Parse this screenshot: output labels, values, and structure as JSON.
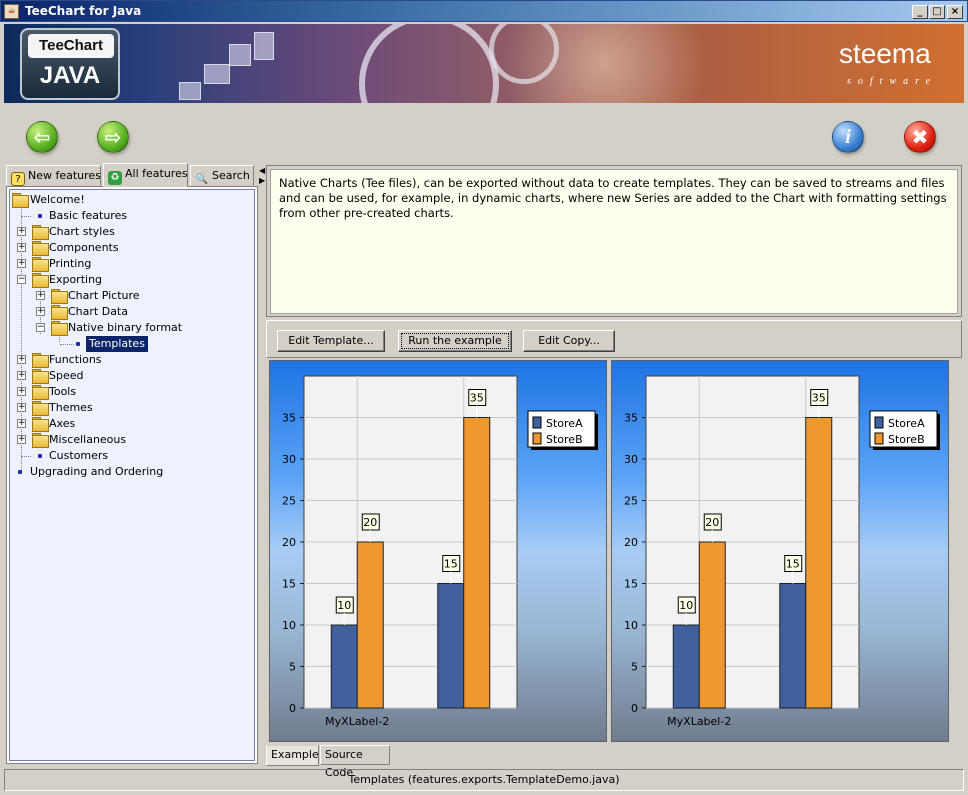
{
  "window": {
    "title": "TeeChart for Java"
  },
  "banner": {
    "logo_top": "TeeChart",
    "logo_bottom": "JAVA",
    "brand": "steema",
    "brand_sub": "software"
  },
  "toolbar": {
    "back_icon": "arrow-left-icon",
    "forward_icon": "arrow-right-icon",
    "info_icon": "info-icon",
    "close_icon": "close-icon",
    "back_glyph": "⇦",
    "forward_glyph": "⇨",
    "info_glyph": "i",
    "close_glyph": "✖"
  },
  "left_tabs": [
    {
      "label": "New features",
      "icon": "lightbulb-icon"
    },
    {
      "label": "All features",
      "icon": "recycle-icon"
    },
    {
      "label": "Search",
      "icon": "magnifier-icon"
    }
  ],
  "tree": {
    "root": "Welcome!",
    "items": [
      {
        "label": "Basic features"
      },
      {
        "label": "Chart styles"
      },
      {
        "label": "Components"
      },
      {
        "label": "Printing"
      },
      {
        "label": "Exporting"
      },
      {
        "label": "Chart Picture"
      },
      {
        "label": "Chart Data"
      },
      {
        "label": "Native binary format"
      },
      {
        "label": "Templates"
      },
      {
        "label": "Functions"
      },
      {
        "label": "Speed"
      },
      {
        "label": "Tools"
      },
      {
        "label": "Themes"
      },
      {
        "label": "Axes"
      },
      {
        "label": "Miscellaneous"
      },
      {
        "label": "Customers"
      },
      {
        "label": "Upgrading and Ordering"
      }
    ]
  },
  "description": "Native Charts (Tee files), can be exported without data to create templates. They can be saved to streams and files and can be used, for example, in dynamic charts, where new Series are added to the Chart with formatting settings from other pre-created charts.",
  "buttons": {
    "edit_template": "Edit Template...",
    "run_example": "Run the example",
    "edit_copy": "Edit Copy..."
  },
  "chart_data": [
    {
      "type": "bar",
      "categories": [
        "MyXLabel-2",
        ""
      ],
      "series": [
        {
          "name": "StoreA",
          "values": [
            10,
            15
          ],
          "color": "#4060a0"
        },
        {
          "name": "StoreB",
          "values": [
            20,
            35
          ],
          "color": "#f09830"
        }
      ],
      "ylim": [
        0,
        40
      ],
      "yticks": [
        "0",
        "5",
        "10",
        "15",
        "20",
        "25",
        "30",
        "35"
      ],
      "legend": "top-right",
      "grid": true
    },
    {
      "type": "bar",
      "categories": [
        "MyXLabel-2",
        ""
      ],
      "series": [
        {
          "name": "StoreA",
          "values": [
            10,
            15
          ],
          "color": "#4060a0"
        },
        {
          "name": "StoreB",
          "values": [
            20,
            35
          ],
          "color": "#f09830"
        }
      ],
      "ylim": [
        0,
        40
      ],
      "yticks": [
        "0",
        "5",
        "10",
        "15",
        "20",
        "25",
        "30",
        "35"
      ],
      "legend": "top-right",
      "grid": true
    }
  ],
  "bottom_tabs": {
    "example": "Example",
    "source_code": "Source Code"
  },
  "status": "Templates  (features.exports.TemplateDemo.java)"
}
